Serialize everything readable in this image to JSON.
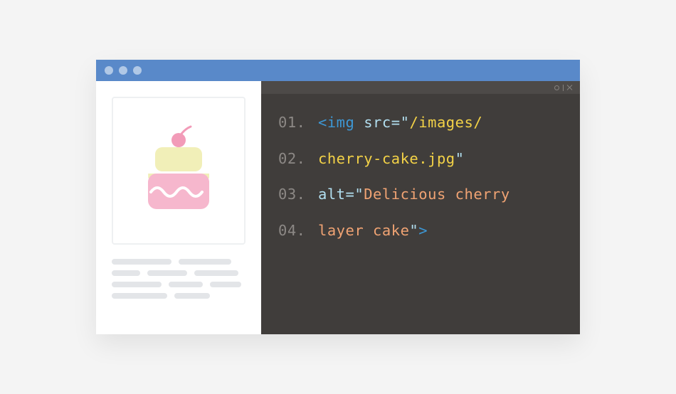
{
  "code": {
    "lines": [
      {
        "num": "01.",
        "segments": [
          {
            "cls": "tok-tag",
            "text": "<img "
          },
          {
            "cls": "tok-attr",
            "text": "src="
          },
          {
            "cls": "tok-punct",
            "text": "\""
          },
          {
            "cls": "tok-path",
            "text": "/images/"
          }
        ]
      },
      {
        "num": "02.",
        "segments": [
          {
            "cls": "tok-path",
            "text": "cherry-cake.jpg"
          },
          {
            "cls": "tok-punct",
            "text": "\""
          }
        ]
      },
      {
        "num": "03.",
        "segments": [
          {
            "cls": "tok-attr",
            "text": "alt="
          },
          {
            "cls": "tok-punct",
            "text": "\""
          },
          {
            "cls": "tok-str",
            "text": "Delicious cherry"
          }
        ]
      },
      {
        "num": "04.",
        "segments": [
          {
            "cls": "tok-str",
            "text": "layer cake"
          },
          {
            "cls": "tok-punct",
            "text": "\""
          },
          {
            "cls": "tok-tag",
            "text": ">"
          }
        ]
      }
    ]
  }
}
